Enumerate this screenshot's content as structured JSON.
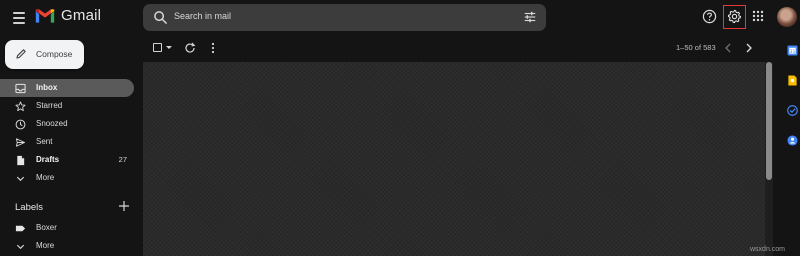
{
  "app": {
    "name": "Gmail"
  },
  "search": {
    "placeholder": "Search in mail"
  },
  "compose": {
    "label": "Compose"
  },
  "nav": {
    "items": [
      {
        "label": "Inbox",
        "icon": "inbox-icon",
        "active": true,
        "count": ""
      },
      {
        "label": "Starred",
        "icon": "star-icon",
        "active": false,
        "count": ""
      },
      {
        "label": "Snoozed",
        "icon": "clock-icon",
        "active": false,
        "count": ""
      },
      {
        "label": "Sent",
        "icon": "send-icon",
        "active": false,
        "count": ""
      },
      {
        "label": "Drafts",
        "icon": "draft-icon",
        "active": false,
        "count": "27"
      },
      {
        "label": "More",
        "icon": "chevron-down-icon",
        "active": false,
        "count": ""
      }
    ]
  },
  "labels": {
    "heading": "Labels",
    "items": [
      {
        "label": "Boxer",
        "icon": "label-icon"
      },
      {
        "label": "More",
        "icon": "chevron-down-icon"
      }
    ]
  },
  "toolbar": {
    "count": "1–50 of 583"
  },
  "header_icons": [
    "menu-icon",
    "gmail-logo-icon",
    "search-icon",
    "tune-icon",
    "help-icon",
    "gear-icon",
    "apps-grid-icon",
    "avatar"
  ],
  "side_panel": [
    "calendar-icon",
    "keep-icon",
    "tasks-icon",
    "contacts-icon"
  ],
  "colors": {
    "background": "#141414",
    "search_bg": "#3c3c3c",
    "active_nav": "#5a5a5a",
    "compose_bg": "#f1f3f4",
    "highlight_box": "#e53935"
  },
  "watermark": "wsxdn.com"
}
